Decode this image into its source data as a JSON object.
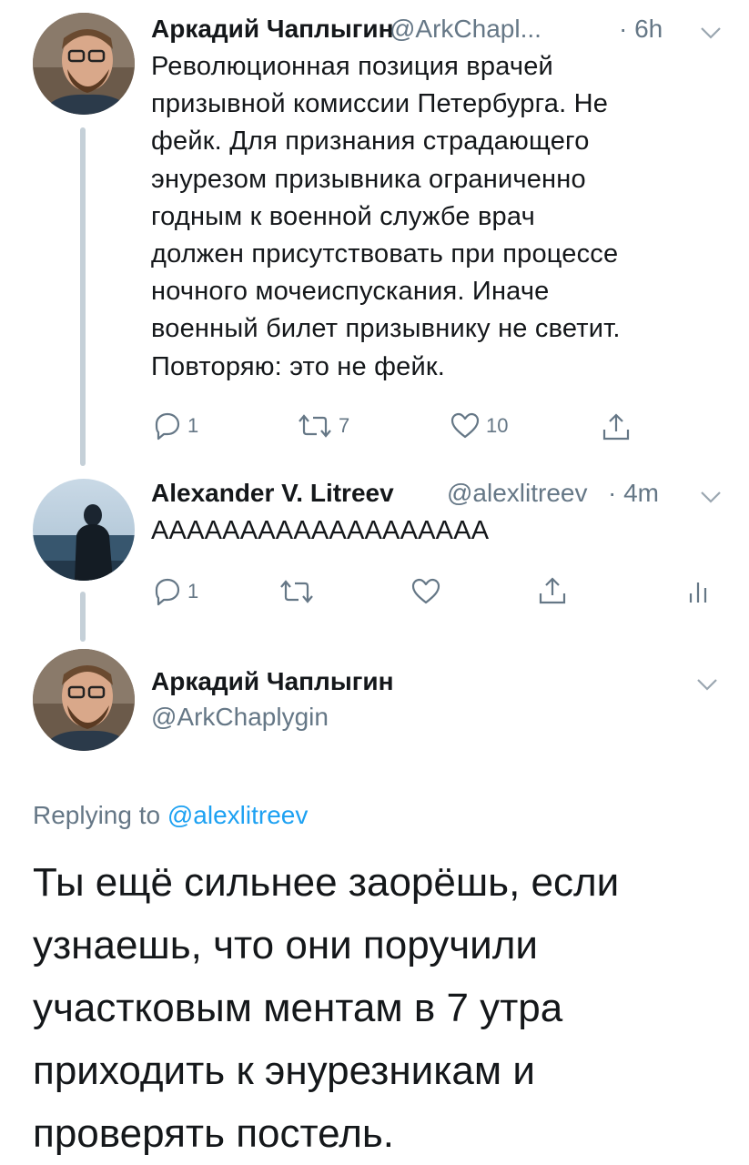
{
  "tweet1": {
    "name": "Аркадий Чаплыгин",
    "handle": "@ArkChapl...",
    "time": "· 6h",
    "lines": [
      "Революционная позиция врачей",
      "призывной комиссии Петербурга. Не",
      "фейк. Для признания страдающего",
      "энурезом призывника ограниченно",
      "годным к военной службе врач",
      "должен присутствовать при процессе",
      "ночного мочеиспускания. Иначе",
      "военный билет призывнику не светит.",
      "Повторяю: это не фейк."
    ],
    "actions": {
      "replies": "1",
      "retweets": "7",
      "likes": "10"
    }
  },
  "tweet2": {
    "name": "Alexander V. Litreev",
    "handle": "@alexlitreev",
    "time": "· 4m",
    "text": "ААААААААААААААААААА",
    "actions": {
      "replies": "1"
    }
  },
  "tweet3": {
    "name": "Аркадий Чаплыгин",
    "handle": "@ArkChaplygin",
    "replying_prefix": "Replying to",
    "replying_to": "@alexlitreev",
    "lines": [
      "Ты ещё сильнее заорёшь, если",
      "узнаешь, что они поручили",
      "участковым ментам в 7 утра",
      "приходить к энурезникам и",
      "проверять постель."
    ]
  },
  "colors": {
    "accent": "#1da1f2",
    "secondary": "#657786",
    "thread_line": "#c5d0d8"
  },
  "icons": [
    "reply-icon",
    "retweet-icon",
    "like-icon",
    "share-icon",
    "analytics-icon",
    "chevron-down-icon"
  ]
}
